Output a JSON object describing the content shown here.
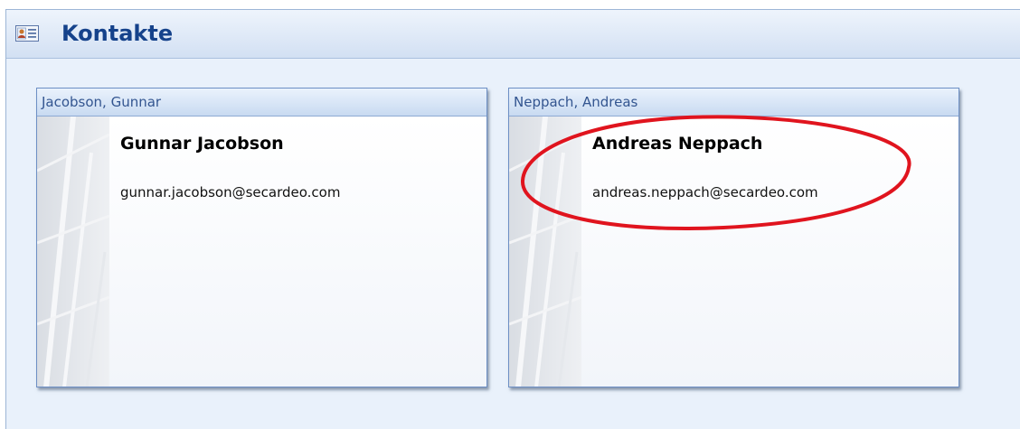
{
  "header": {
    "title": "Kontakte",
    "icon": "contact-card-icon"
  },
  "contacts": [
    {
      "header": "Jacobson, Gunnar",
      "name": "Gunnar Jacobson",
      "email": "gunnar.jacobson@secardeo.com"
    },
    {
      "header": "Neppach, Andreas",
      "name": "Andreas Neppach",
      "email": "andreas.neppach@secardeo.com"
    }
  ],
  "colors": {
    "title": "#15428b",
    "card_border": "#6d8fc5",
    "highlight_ellipse": "#e0141e"
  }
}
